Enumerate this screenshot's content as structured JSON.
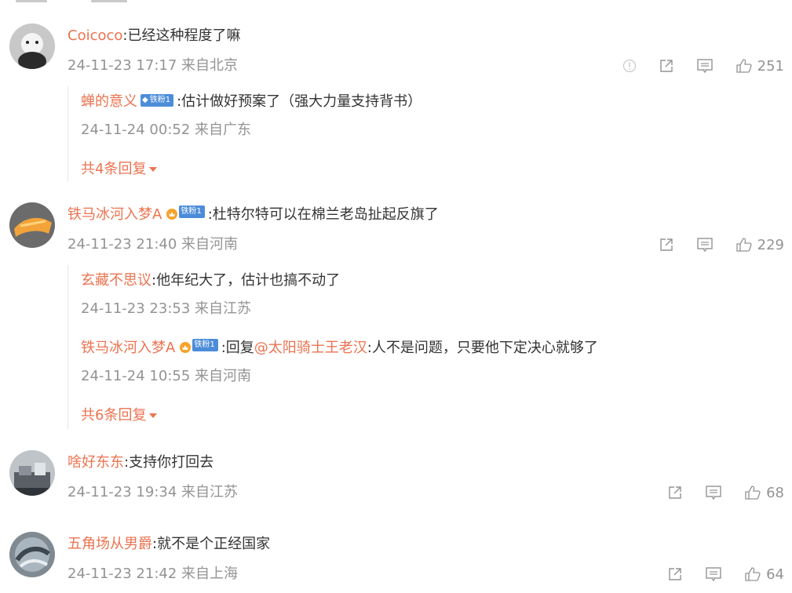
{
  "comments": [
    {
      "user": "Coicoco",
      "text": ":已经这种程度了嘛",
      "time": "24-11-23 17:17 来自北京",
      "likes": "251",
      "replies": [
        {
          "user": "蝉的意义",
          "badge": "铁粉1",
          "text": ":估计做好预案了（强大力量支持背书）",
          "time": "24-11-24 00:52 来自广东"
        }
      ],
      "more": "共4条回复"
    },
    {
      "user": "铁马冰河入梦A",
      "badge": "铁粉1",
      "text": ":杜特尔特可以在棉兰老岛扯起反旗了",
      "time": "24-11-23 21:40 来自河南",
      "likes": "229",
      "replies": [
        {
          "user": "玄藏不思议",
          "text": ":他年纪大了，估计也搞不动了",
          "time": "24-11-23 23:53 来自江苏"
        },
        {
          "user": "铁马冰河入梦A",
          "badge": "铁粉1",
          "prefix": ":回复",
          "mention": "@太阳骑士王老汉",
          "text": ":人不是问题，只要他下定决心就够了",
          "time": "24-11-24 10:55 来自河南"
        }
      ],
      "more": "共6条回复"
    },
    {
      "user": "啥好东东",
      "text": ":支持你打回去",
      "time": "24-11-23 19:34 来自江苏",
      "likes": "68"
    },
    {
      "user": "五角场从男爵",
      "text": ":就不是个正经国家",
      "time": "24-11-23 21:42 来自上海",
      "likes": "64"
    }
  ]
}
